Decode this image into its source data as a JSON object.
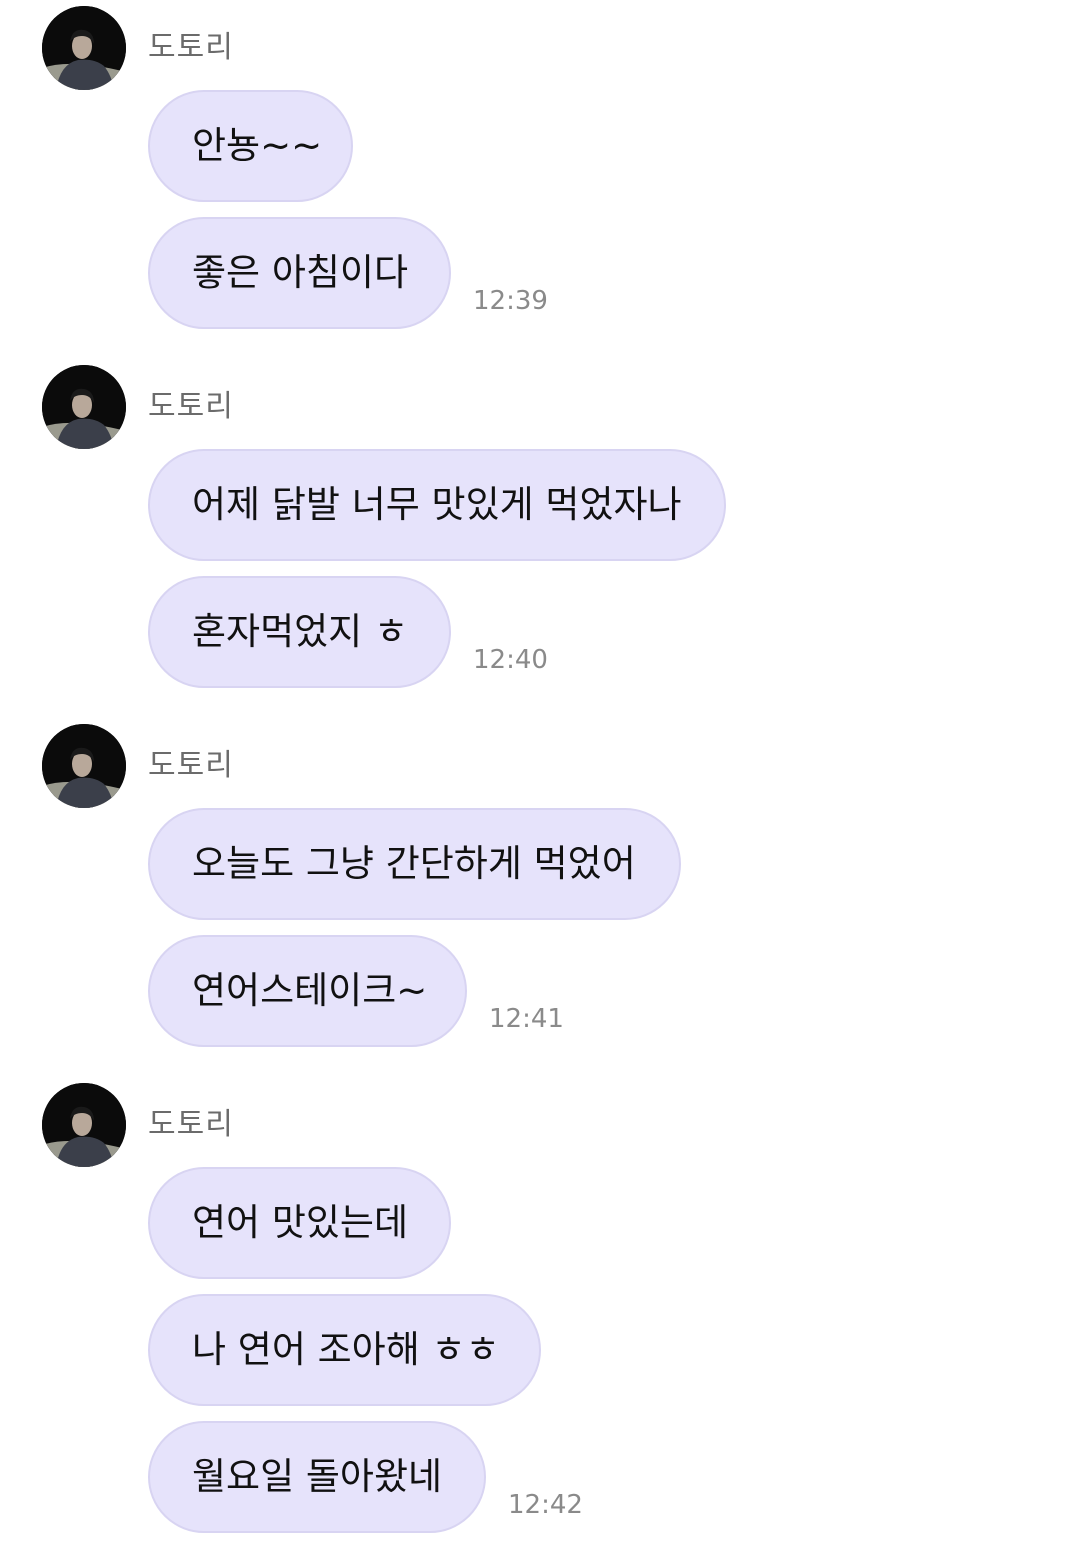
{
  "groups": [
    {
      "sender": "도토리",
      "messages": [
        "안뇽~~",
        "좋은 아침이다"
      ],
      "time": "12:39"
    },
    {
      "sender": "도토리",
      "messages": [
        "어제 닭발 너무 맛있게 먹었자나",
        "혼자먹었지 ㅎ"
      ],
      "time": "12:40"
    },
    {
      "sender": "도토리",
      "messages": [
        "오늘도 그냥 간단하게 먹었어",
        "연어스테이크~"
      ],
      "time": "12:41"
    },
    {
      "sender": "도토리",
      "messages": [
        "연어 맛있는데",
        "나 연어 조아해 ㅎㅎ",
        "월요일 돌아왔네"
      ],
      "time": "12:42"
    }
  ],
  "colors": {
    "bubble": "#e6e3fb",
    "bubble_border": "#d8d4f2",
    "sender_text": "#6b6b6b",
    "time_text": "#8a8a8a"
  },
  "icons": {
    "avatar": "profile-photo-icon"
  }
}
